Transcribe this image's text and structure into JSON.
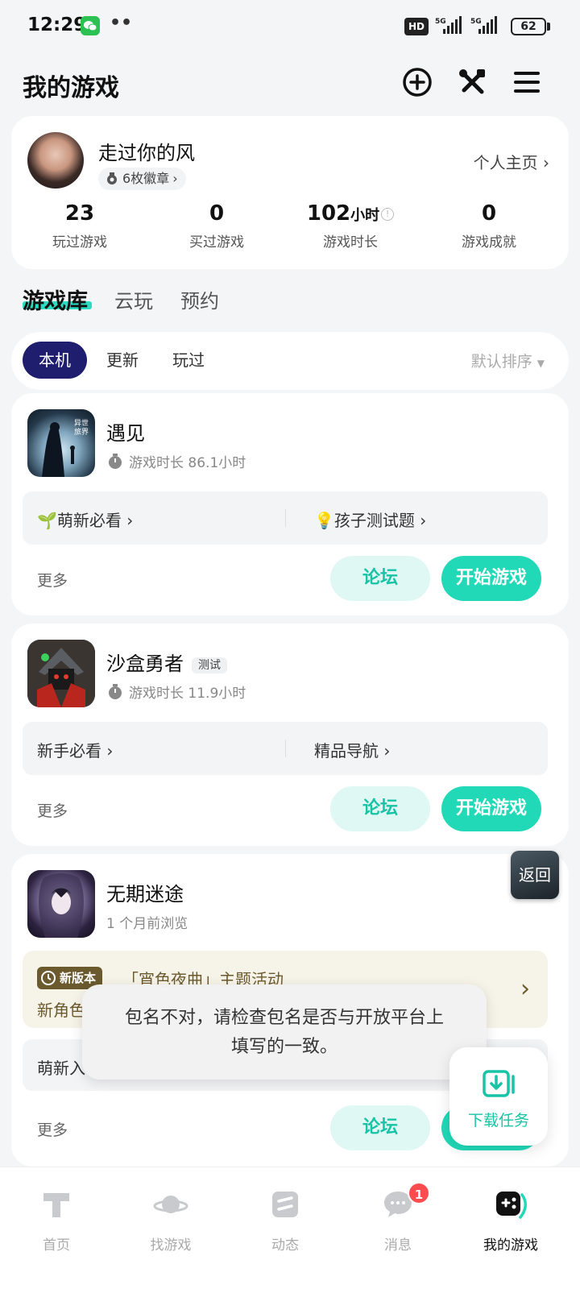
{
  "status_bar": {
    "time": "12:29",
    "dots": "••",
    "hd": "HD",
    "net1": "5G",
    "net2": "5G",
    "battery": "62"
  },
  "header": {
    "title": "我的游戏"
  },
  "profile": {
    "username": "走过你的风",
    "badges": "6枚徽章",
    "home_link": "个人主页",
    "stats": [
      {
        "value": "23",
        "unit": "",
        "label": "玩过游戏"
      },
      {
        "value": "0",
        "unit": "",
        "label": "买过游戏"
      },
      {
        "value": "102",
        "unit": "小时",
        "label": "游戏时长"
      },
      {
        "value": "0",
        "unit": "",
        "label": "游戏成就"
      }
    ]
  },
  "library_tabs": [
    "游戏库",
    "云玩",
    "预约"
  ],
  "filters": {
    "chips": [
      "本机",
      "更新",
      "玩过"
    ],
    "sort": "默认排序"
  },
  "games": [
    {
      "name": "遇见",
      "subtitle": "游戏时长 86.1小时",
      "links": [
        "萌新必看",
        "孩子测试题"
      ],
      "link_emojis": [
        "🌱",
        "💡"
      ],
      "more": "更多",
      "forum": "论坛",
      "start": "开始游戏",
      "icon_text": "异世\n旅界"
    },
    {
      "name": "沙盒勇者",
      "tag": "测试",
      "subtitle": "游戏时长 11.9小时",
      "links": [
        "新手必看",
        "精品导航"
      ],
      "more": "更多",
      "forum": "论坛",
      "start": "开始游戏"
    },
    {
      "name": "无期迷途",
      "subtitle": "1 个月前浏览",
      "event_badge": "新版本",
      "event_title": "「宵色夜曲」主题活动",
      "event_sub": "新角色",
      "link_partial": "萌新入",
      "more": "更多",
      "forum": "论坛"
    }
  ],
  "toast": {
    "line1": "包名不对，请检查包名是否与开放平台上",
    "line2": "填写的一致。"
  },
  "download_task": {
    "label": "下载任务"
  },
  "return_button": {
    "label": "返回"
  },
  "bottom_nav": [
    {
      "label": "首页"
    },
    {
      "label": "找游戏"
    },
    {
      "label": "动态"
    },
    {
      "label": "消息",
      "badge": "1"
    },
    {
      "label": "我的游戏"
    }
  ],
  "colors": {
    "accent": "#21d9b7",
    "chip_active": "#1f1d6e",
    "forum_bg": "#dff8f3",
    "event_text": "#6b5a2e"
  }
}
